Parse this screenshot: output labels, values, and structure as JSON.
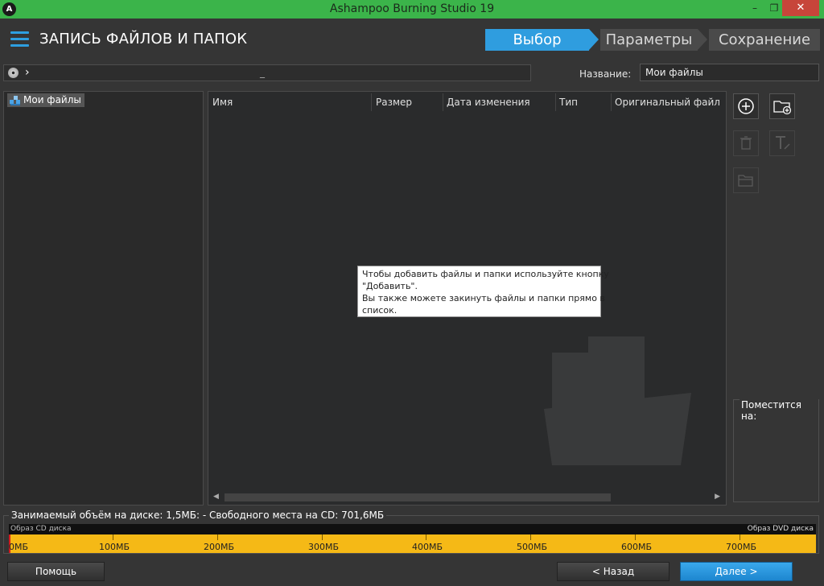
{
  "window": {
    "title": "Ashampoo Burning Studio 19",
    "logo": "A",
    "minimize": "–",
    "maximize": "❐",
    "close": "✕"
  },
  "header": {
    "title": "ЗАПИСЬ ФАЙЛОВ И ПАПОК",
    "steps": [
      "Выбор",
      "Параметры",
      "Сохранение"
    ],
    "active_step": 0,
    "accent": "#2f9ddf"
  },
  "pathbar": {
    "chevron": "›",
    "cursor": "_"
  },
  "name_field": {
    "label": "Название:",
    "value": "Мои файлы"
  },
  "tree": {
    "root": "Мои файлы"
  },
  "file_list": {
    "columns": [
      "Имя",
      "Размер",
      "Дата изменения",
      "Тип",
      "Оригинальный файл"
    ],
    "rows": [],
    "hint_lines": [
      "Чтобы добавить файлы и папки используйте кнопку",
      "\"Добавить\".",
      "Вы также можете закинуть файлы и папки прямо в",
      "список."
    ],
    "scroll_left": "◀",
    "scroll_right": "▶"
  },
  "tools": [
    {
      "name": "add-icon",
      "enabled": true
    },
    {
      "name": "new-folder-icon",
      "enabled": true
    },
    {
      "name": "delete-icon",
      "enabled": false
    },
    {
      "name": "rename-icon",
      "enabled": false
    },
    {
      "name": "open-folder-icon",
      "enabled": false
    }
  ],
  "fits": {
    "label": "Поместится на:"
  },
  "usage": {
    "text": "Занимаемый объём на диске: 1,5МБ: - Свободного места на CD: 701,6МБ",
    "cd_label": "Образ CD диска",
    "dvd_label": "Образ DVD диска",
    "ticks": [
      "0МБ",
      "100МБ",
      "200МБ",
      "300МБ",
      "400МБ",
      "500МБ",
      "600МБ",
      "700МБ"
    ],
    "bar_color": "#f5b916",
    "used_color": "#d61d1d"
  },
  "buttons": {
    "help": "Помощь",
    "back": "< Назад",
    "next": "Далее >"
  }
}
